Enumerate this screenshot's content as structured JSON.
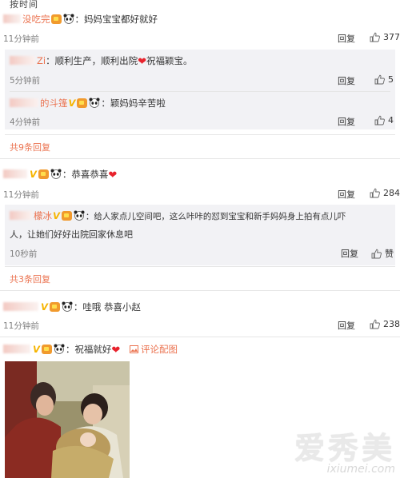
{
  "top_cut_text": "按时间",
  "comments": [
    {
      "username": "没吃完",
      "text": "妈妈宝宝都好就好",
      "time": "11分钟前",
      "reply": "回复",
      "likes": "377"
    },
    {
      "username": "Zi",
      "text": "：顺利生产，顺利出院",
      "text_after_heart": "祝福颖宝。",
      "time": "5分钟前",
      "reply": "回复",
      "likes": "5"
    },
    {
      "username": "的斗篷",
      "text": "：颖妈妈辛苦啦",
      "time": "4分钟前",
      "reply": "回复",
      "likes": "4"
    },
    {
      "more_replies": "共9条回复"
    },
    {
      "username": "",
      "text": "：恭喜恭喜",
      "time": "11分钟前",
      "reply": "回复",
      "likes": "284"
    },
    {
      "username": "檬冰",
      "text": "：给人家点儿空间吧，这么咔咔的怼到宝宝和新手妈妈身上拍有点儿吓",
      "text_line2": "人，让她们好好出院回家休息吧",
      "time": "10秒前",
      "reply": "回复",
      "likes": "赞"
    },
    {
      "more_replies": "共3条回复"
    },
    {
      "username": "",
      "text": "：哇哦 恭喜小赵",
      "time": "11分钟前",
      "reply": "回复",
      "likes": "238"
    },
    {
      "username": "",
      "text": "：祝福就好",
      "pic_link": "评论配图"
    }
  ],
  "watermark": {
    "big": "爱秀美",
    "small": "ixiumei.com"
  },
  "colors": {
    "username": "#eb7350",
    "sub_bg": "#f2f2f5",
    "heart": "#e8232d"
  }
}
